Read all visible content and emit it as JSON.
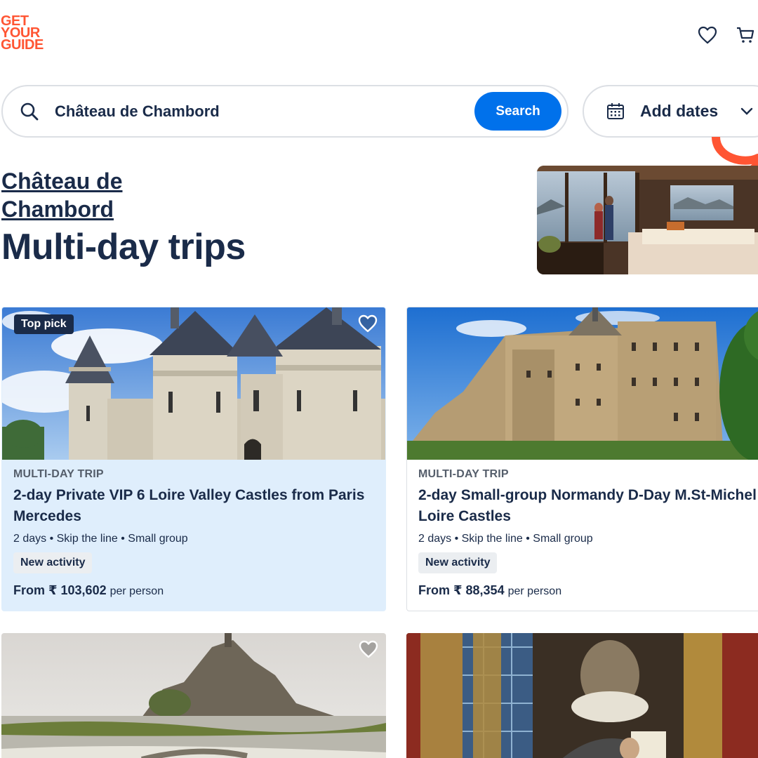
{
  "logo": {
    "line1": "GET",
    "line2": "YOUR",
    "line3": "GUIDE"
  },
  "header": {
    "wishlist_icon": "heart-icon",
    "cart_icon": "cart-icon"
  },
  "search": {
    "value": "Château de Chambord",
    "button": "Search",
    "icon": "search-icon"
  },
  "dates": {
    "label": "Add dates",
    "icon": "calendar-icon"
  },
  "location": {
    "name": "Château de Chambord"
  },
  "page": {
    "title": "Multi-day trips"
  },
  "cards": [
    {
      "badge": "Top pick",
      "category": "MULTI-DAY TRIP",
      "title": "2-day Private VIP 6 Loire Valley Castles from Paris Mercedes",
      "meta": "2 days • Skip the line • Small group",
      "tag": "New activity",
      "price_prefix": "From ₹ 103,602",
      "price_suffix": "per person"
    },
    {
      "category": "MULTI-DAY TRIP",
      "title": "2-day Small-group Normandy D-Day M.St-Michel Loire Castles",
      "meta": "2 days • Skip the line • Small group",
      "tag": "New activity",
      "price_prefix": "From ₹ 88,354",
      "price_suffix": "per person"
    }
  ],
  "colors": {
    "brand": "#ff5533",
    "primary": "#0071eb",
    "text": "#1a2b49",
    "active_card": "#dfeefc"
  }
}
